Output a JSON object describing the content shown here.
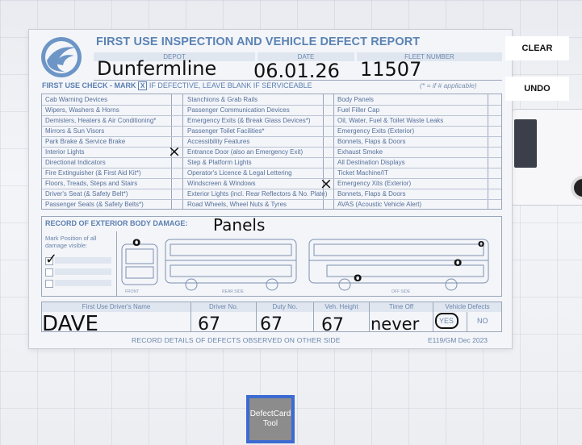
{
  "report": {
    "title": "FIRST USE INSPECTION AND VEHICLE DEFECT REPORT",
    "header": {
      "depot": "DEPOT",
      "date": "DATE",
      "fleet": "FLEET NUMBER"
    },
    "handwritten": {
      "depot": "Dunfermline",
      "date": "06.01.26",
      "fleet": "11507",
      "damage_note": "Panels",
      "driver": "DAVE",
      "driver_no": "67",
      "duty_no": "67",
      "veh_height": "67",
      "time_off": "never"
    },
    "check_title_a": "FIRST USE CHECK - MARK",
    "check_title_x": "X",
    "check_title_b": "IF DEFECTIVE, LEAVE BLANK IF SERVICEABLE",
    "applicable_note": "(* =  if # applicable)",
    "col1": [
      "Cab Warning Devices",
      "Wipers, Washers & Horns",
      "Demisters, Heaters & Air Conditioning*",
      "Mirrors & Sun Visors",
      "Park Brake & Service Brake",
      "Interior Lights",
      "Directional Indicators",
      "Fire Extinguisher (& First Aid Kit*)",
      "Floors, Treads, Steps and Stairs",
      "Driver's Seat (& Safety Belt*)",
      "Passenger Seats (& Safety Belts*)"
    ],
    "col2": [
      "Stanchions & Grab Rails",
      "Passenger Communication Devices",
      "Emergency Exits (& Break Glass Devices*)",
      "Passenger Toilet Facilities*",
      "Accessibility Features",
      "Entrance Door (also an Emergency Exit)",
      "Step & Platform Lights",
      "Operator's Licence & Legal Lettering",
      "Windscreen & Windows",
      "Exterior Lights (incl. Rear Reflectors & No. Plate)",
      "Road Wheels, Wheel Nuts & Tyres"
    ],
    "col3": [
      "Body Panels",
      "Fuel Filler Cap",
      "Oil, Water, Fuel & Toilet Waste Leaks",
      "Emergency Exits (Exterior)",
      "Bonnets, Flaps & Doors",
      "Exhaust Smoke",
      "All Destination Displays",
      "Ticket Machine/IT",
      "Emergency Xits (Exterior)",
      "Bonnets, Flaps & Doors",
      "AVAS (Acoustic Vehicle Alert)"
    ],
    "marks": {
      "x_symbol": "×",
      "tick_symbol": "✓",
      "dot_symbol": "o"
    },
    "damage_title": "RECORD OF EXTERIOR BODY DAMAGE:",
    "damage_mark_text": "Mark Position of all damage visible:",
    "view_labels": [
      "FRONT",
      "REAR SIDE",
      "OFF SIDE"
    ],
    "footer": {
      "cols": [
        "First Use Driver's Name",
        "Driver No.",
        "Duty No.",
        "Veh. Height",
        "Time Off",
        "Vehicle Defects"
      ],
      "yes": "YES",
      "no": "NO"
    },
    "bottom_note": "RECORD DETAILS OF DEFECTS OBSERVED ON OTHER SIDE",
    "form_code": "E119/GM Dec 2023"
  },
  "buttons": {
    "clear": "CLEAR",
    "undo": "UNDO"
  },
  "toolbar": {
    "tool_label": "DefectCard Tool"
  }
}
